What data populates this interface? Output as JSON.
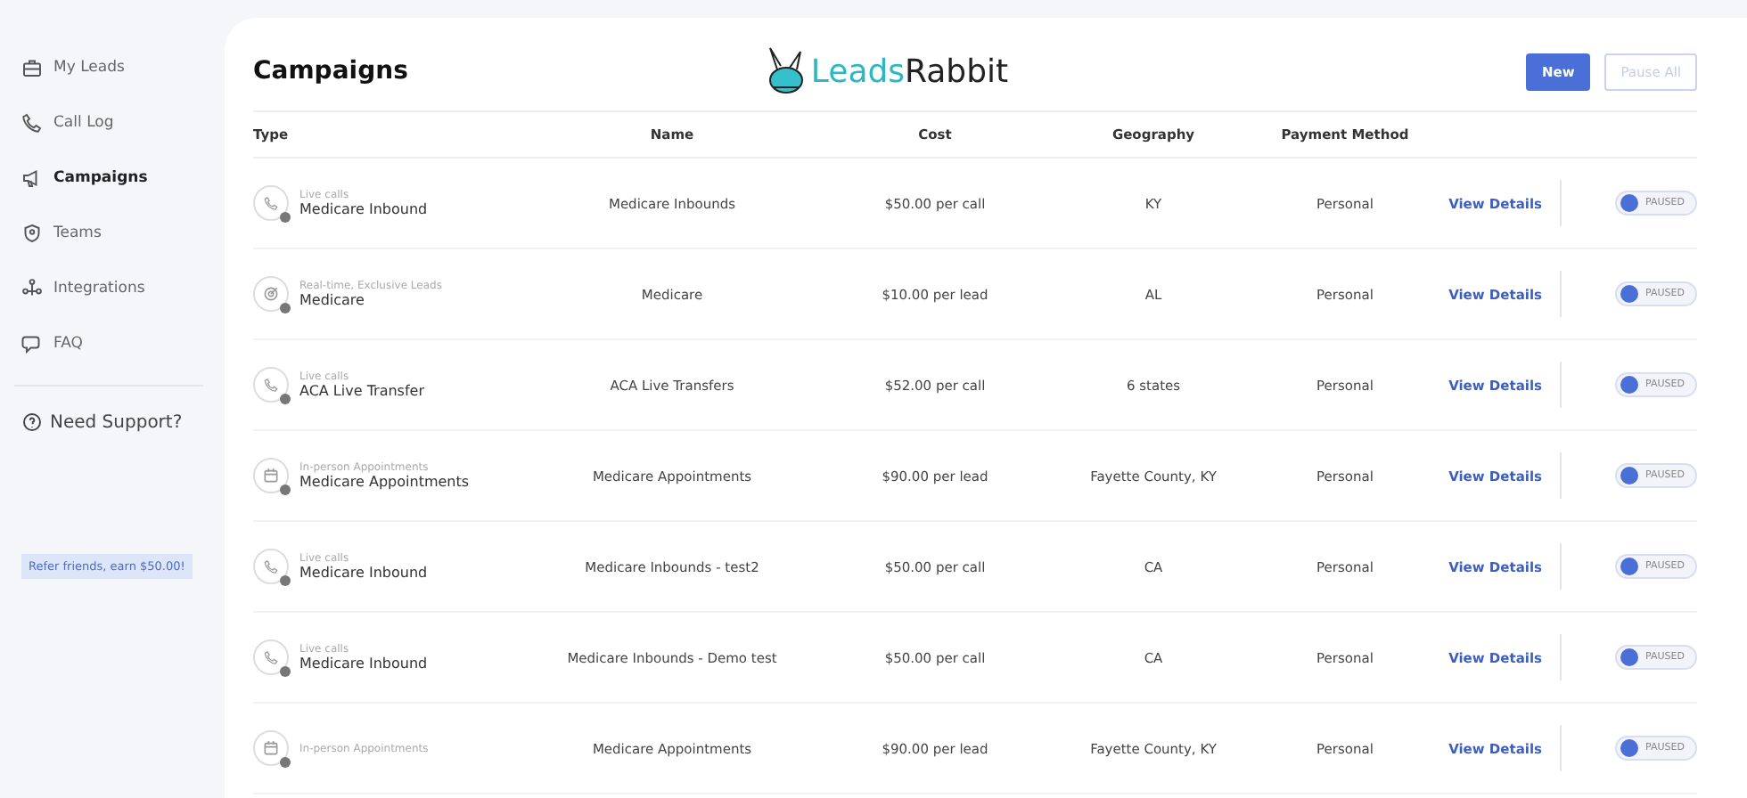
{
  "sidebar": {
    "items": [
      {
        "label": "My Leads",
        "selected": false
      },
      {
        "label": "Call Log",
        "selected": false
      },
      {
        "label": "Campaigns",
        "selected": true
      },
      {
        "label": "Teams",
        "selected": false
      },
      {
        "label": "Integrations",
        "selected": false
      },
      {
        "label": "FAQ",
        "selected": false
      }
    ],
    "support": "Need Support?",
    "referral": "Refer friends, earn $50.00!"
  },
  "logo": {
    "first": "Leads",
    "second": "Rabbit"
  },
  "header": {
    "title": "Campaigns",
    "buttons": [
      {
        "label": "New",
        "kind": "primary",
        "disabled": false
      },
      {
        "label": "Pause All",
        "kind": "outline",
        "disabled": true
      }
    ]
  },
  "table": {
    "columns": [
      "Type",
      "Name",
      "Cost",
      "Geography",
      "Payment Method"
    ],
    "rows": [
      {
        "kind": "phone",
        "type_label": "Live calls",
        "type_title": "Medicare Inbound",
        "name": "Medicare Inbounds",
        "cost": "$50.00 per call",
        "geography": "KY",
        "payment": "Personal",
        "action": "View Details",
        "toggle": {
          "on": false,
          "label": "PAUSED"
        }
      },
      {
        "kind": "target",
        "type_label": "Real-time, Exclusive Leads",
        "type_title": "Medicare",
        "name": "Medicare",
        "cost": "$10.00 per lead",
        "geography": "AL",
        "payment": "Personal",
        "action": "View Details",
        "toggle": {
          "on": false,
          "label": "PAUSED"
        }
      },
      {
        "kind": "phone",
        "type_label": "Live calls",
        "type_title": "ACA Live Transfer",
        "name": "ACA Live Transfers",
        "cost": "$52.00 per call",
        "geography": "6 states",
        "payment": "Personal",
        "action": "View Details",
        "toggle": {
          "on": false,
          "label": "PAUSED"
        }
      },
      {
        "kind": "calendar",
        "type_label": "In-person Appointments",
        "type_title": "Medicare Appointments",
        "name": "Medicare Appointments",
        "cost": "$90.00 per lead",
        "geography": "Fayette County, KY",
        "payment": "Personal",
        "action": "View Details",
        "toggle": {
          "on": false,
          "label": "PAUSED"
        }
      },
      {
        "kind": "phone",
        "type_label": "Live calls",
        "type_title": "Medicare Inbound",
        "name": "Medicare Inbounds - test2",
        "cost": "$50.00 per call",
        "geography": "CA",
        "payment": "Personal",
        "action": "View Details",
        "toggle": {
          "on": false,
          "label": "PAUSED"
        }
      },
      {
        "kind": "phone",
        "type_label": "Live calls",
        "type_title": "Medicare Inbound",
        "name": "Medicare Inbounds - Demo test",
        "cost": "$50.00 per call",
        "geography": "CA",
        "payment": "Personal",
        "action": "View Details",
        "toggle": {
          "on": false,
          "label": "PAUSED"
        }
      },
      {
        "kind": "calendar",
        "type_label": "In-person Appointments",
        "name": "Medicare Appointments",
        "cost": "$90.00 per lead",
        "geography": "Fayette County, KY",
        "payment": "Personal",
        "action": "View Details",
        "toggle": {
          "on": false,
          "label": "PAUSED"
        }
      }
    ]
  }
}
